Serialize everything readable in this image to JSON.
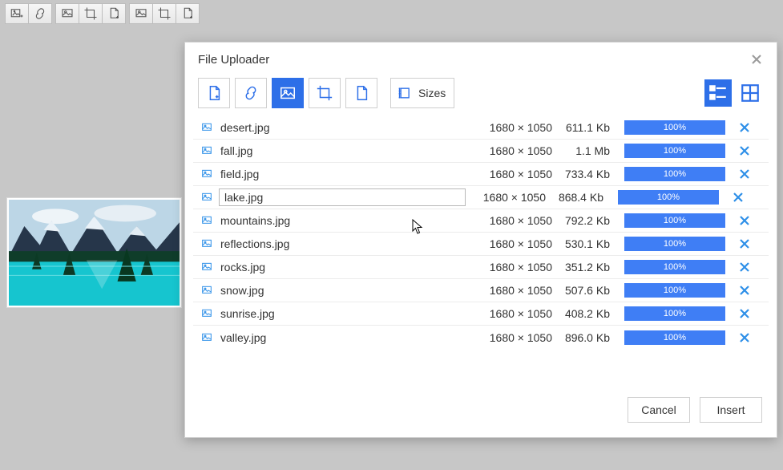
{
  "dialog": {
    "title": "File Uploader",
    "sizes_label": "Sizes",
    "cancel_label": "Cancel",
    "insert_label": "Insert"
  },
  "editing_index": 3,
  "files": [
    {
      "name": "desert.jpg",
      "dim": "1680 × 1050",
      "size": "611.1 Kb",
      "progress": "100%"
    },
    {
      "name": "fall.jpg",
      "dim": "1680 × 1050",
      "size": "1.1 Mb",
      "progress": "100%"
    },
    {
      "name": "field.jpg",
      "dim": "1680 × 1050",
      "size": "733.4 Kb",
      "progress": "100%"
    },
    {
      "name": "lake.jpg",
      "dim": "1680 × 1050",
      "size": "868.4 Kb",
      "progress": "100%"
    },
    {
      "name": "mountains.jpg",
      "dim": "1680 × 1050",
      "size": "792.2 Kb",
      "progress": "100%"
    },
    {
      "name": "reflections.jpg",
      "dim": "1680 × 1050",
      "size": "530.1 Kb",
      "progress": "100%"
    },
    {
      "name": "rocks.jpg",
      "dim": "1680 × 1050",
      "size": "351.2 Kb",
      "progress": "100%"
    },
    {
      "name": "snow.jpg",
      "dim": "1680 × 1050",
      "size": "507.6 Kb",
      "progress": "100%"
    },
    {
      "name": "sunrise.jpg",
      "dim": "1680 × 1050",
      "size": "408.2 Kb",
      "progress": "100%"
    },
    {
      "name": "valley.jpg",
      "dim": "1680 × 1050",
      "size": "896.0 Kb",
      "progress": "100%"
    }
  ]
}
